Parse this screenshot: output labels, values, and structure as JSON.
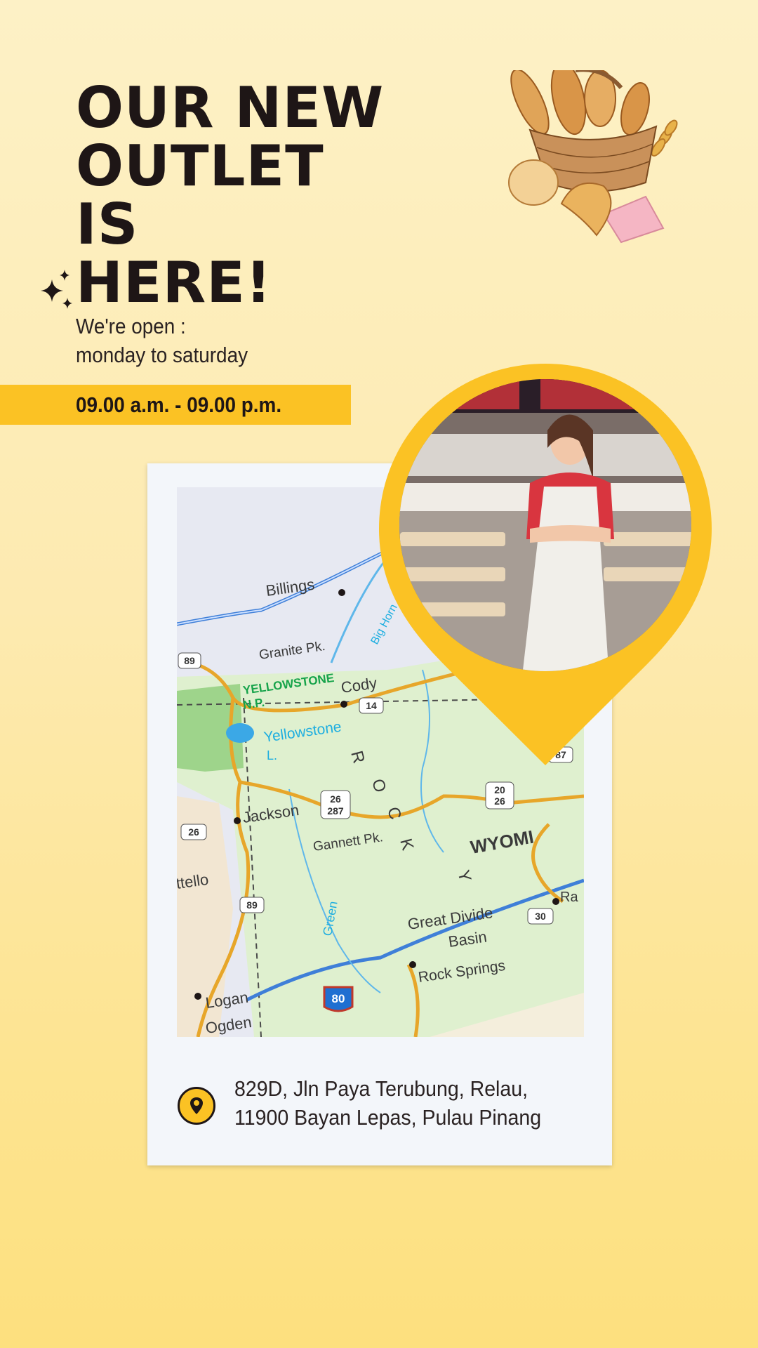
{
  "headline": {
    "line1": "OUR NEW",
    "line2": "OUTLET IS",
    "line3": "HERE!"
  },
  "schedule": {
    "open_label": "We're open :",
    "days": "monday to saturday",
    "hours": "09.00 a.m. - 09.00 p.m."
  },
  "map": {
    "labels": [
      "Billings",
      "Granite Pk.",
      "YELLOWSTONE",
      "N.P.",
      "Cody",
      "Yellowstone",
      "L.",
      "Jackson",
      "Gannett Pk.",
      "R",
      "O",
      "C",
      "K",
      "Y",
      "WYOMI",
      "Great Divide",
      "Basin",
      "Rock Springs",
      "Logan",
      "Ogden",
      "ttello",
      "Green",
      "Big Horn",
      "Ra"
    ],
    "route_shields": [
      "89",
      "14",
      "26",
      "287",
      "20",
      "26",
      "26",
      "89",
      "30",
      "80",
      "87"
    ]
  },
  "address": {
    "line1": "829D, Jln Paya Terubung, Relau,",
    "line2": "11900 Bayan Lepas, Pulau Pinang"
  },
  "colors": {
    "accent": "#fbc224",
    "ink": "#1e1616",
    "background_top": "#fdf1c6",
    "background_bottom": "#fde07e"
  },
  "icons": {
    "sparkle": "sparkle-icon",
    "location": "location-pin-icon"
  }
}
